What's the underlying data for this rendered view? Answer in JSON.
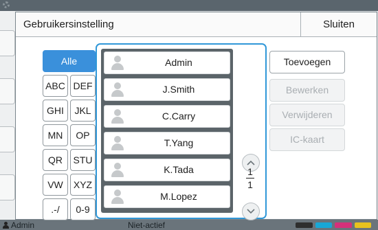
{
  "dialog": {
    "title": "Gebruikersinstelling",
    "close_label": "Sluiten"
  },
  "filters": {
    "all": "Alle",
    "groups": [
      "ABC",
      "DEF",
      "GHI",
      "JKL",
      "MN",
      "OP",
      "QR",
      "STU",
      "VW",
      "XYZ",
      ".-/",
      "0-9"
    ],
    "selected": "Alle"
  },
  "users": [
    "Admin",
    "J.Smith",
    "C.Carry",
    "T.Yang",
    "K.Tada",
    "M.Lopez"
  ],
  "pagination": {
    "current": "1",
    "total": "1"
  },
  "actions": {
    "add": "Toevoegen",
    "edit": "Bewerken",
    "delete": "Verwijderen",
    "ic_card": "IC-kaart"
  },
  "statusbar": {
    "user": "Admin",
    "printer": "Niet-actief"
  },
  "colors": {
    "accent": "#3a90db",
    "list_frame": "#2f97d8",
    "list_background": "#5b6469"
  }
}
